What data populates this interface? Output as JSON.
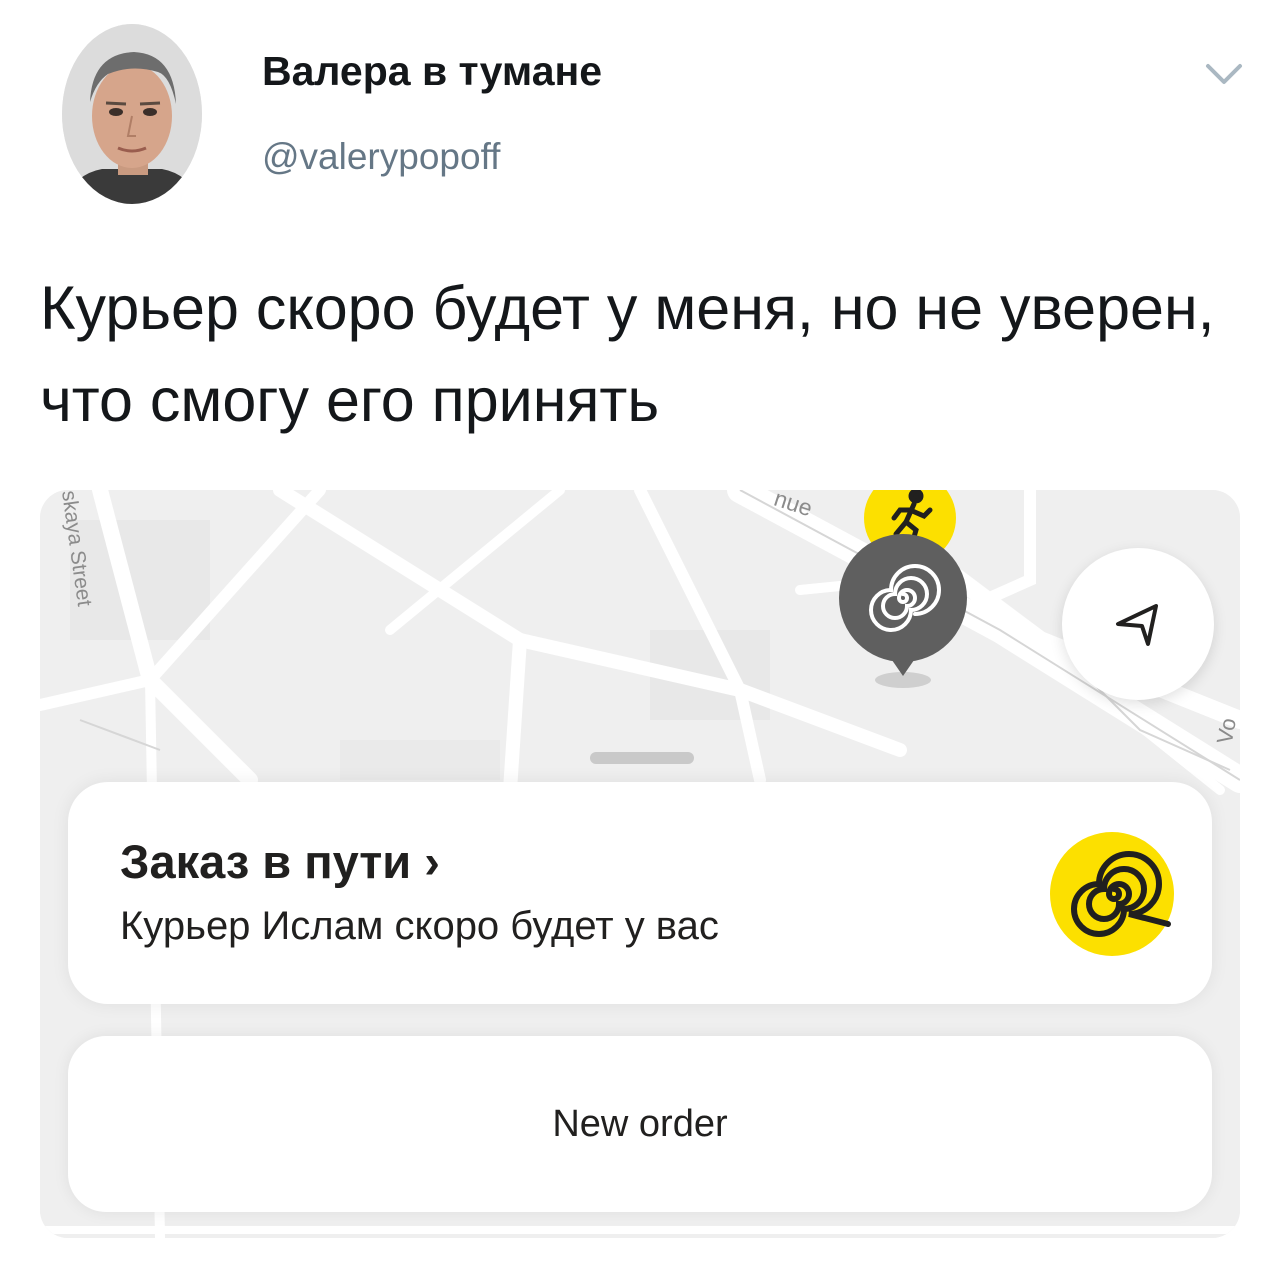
{
  "author": {
    "name": "Валера в тумане",
    "handle": "@valerypopoff"
  },
  "tweet": {
    "text": "Курьер скоро будет у меня, но не уверен, что смогу его принять"
  },
  "media": {
    "map": {
      "street_label": "skaya Street",
      "avenue_label": "nue",
      "edge_label": "Vo"
    },
    "order_status": {
      "title": "Заказ в пути",
      "chevron": "›",
      "subtitle": "Курьер Ислам скоро будет у вас"
    },
    "new_order_button": {
      "label": "New order"
    },
    "icons": {
      "courier": "courier-icon",
      "destination": "spiral-pin-icon",
      "locate": "locate-arrow-icon",
      "brand": "spiral-logo-icon",
      "menu": "chevron-down-icon"
    },
    "colors": {
      "brand_yellow": "#fce000",
      "pin_gray": "#5f5f5f",
      "map_background": "#efefef",
      "road": "#ffffff"
    }
  }
}
